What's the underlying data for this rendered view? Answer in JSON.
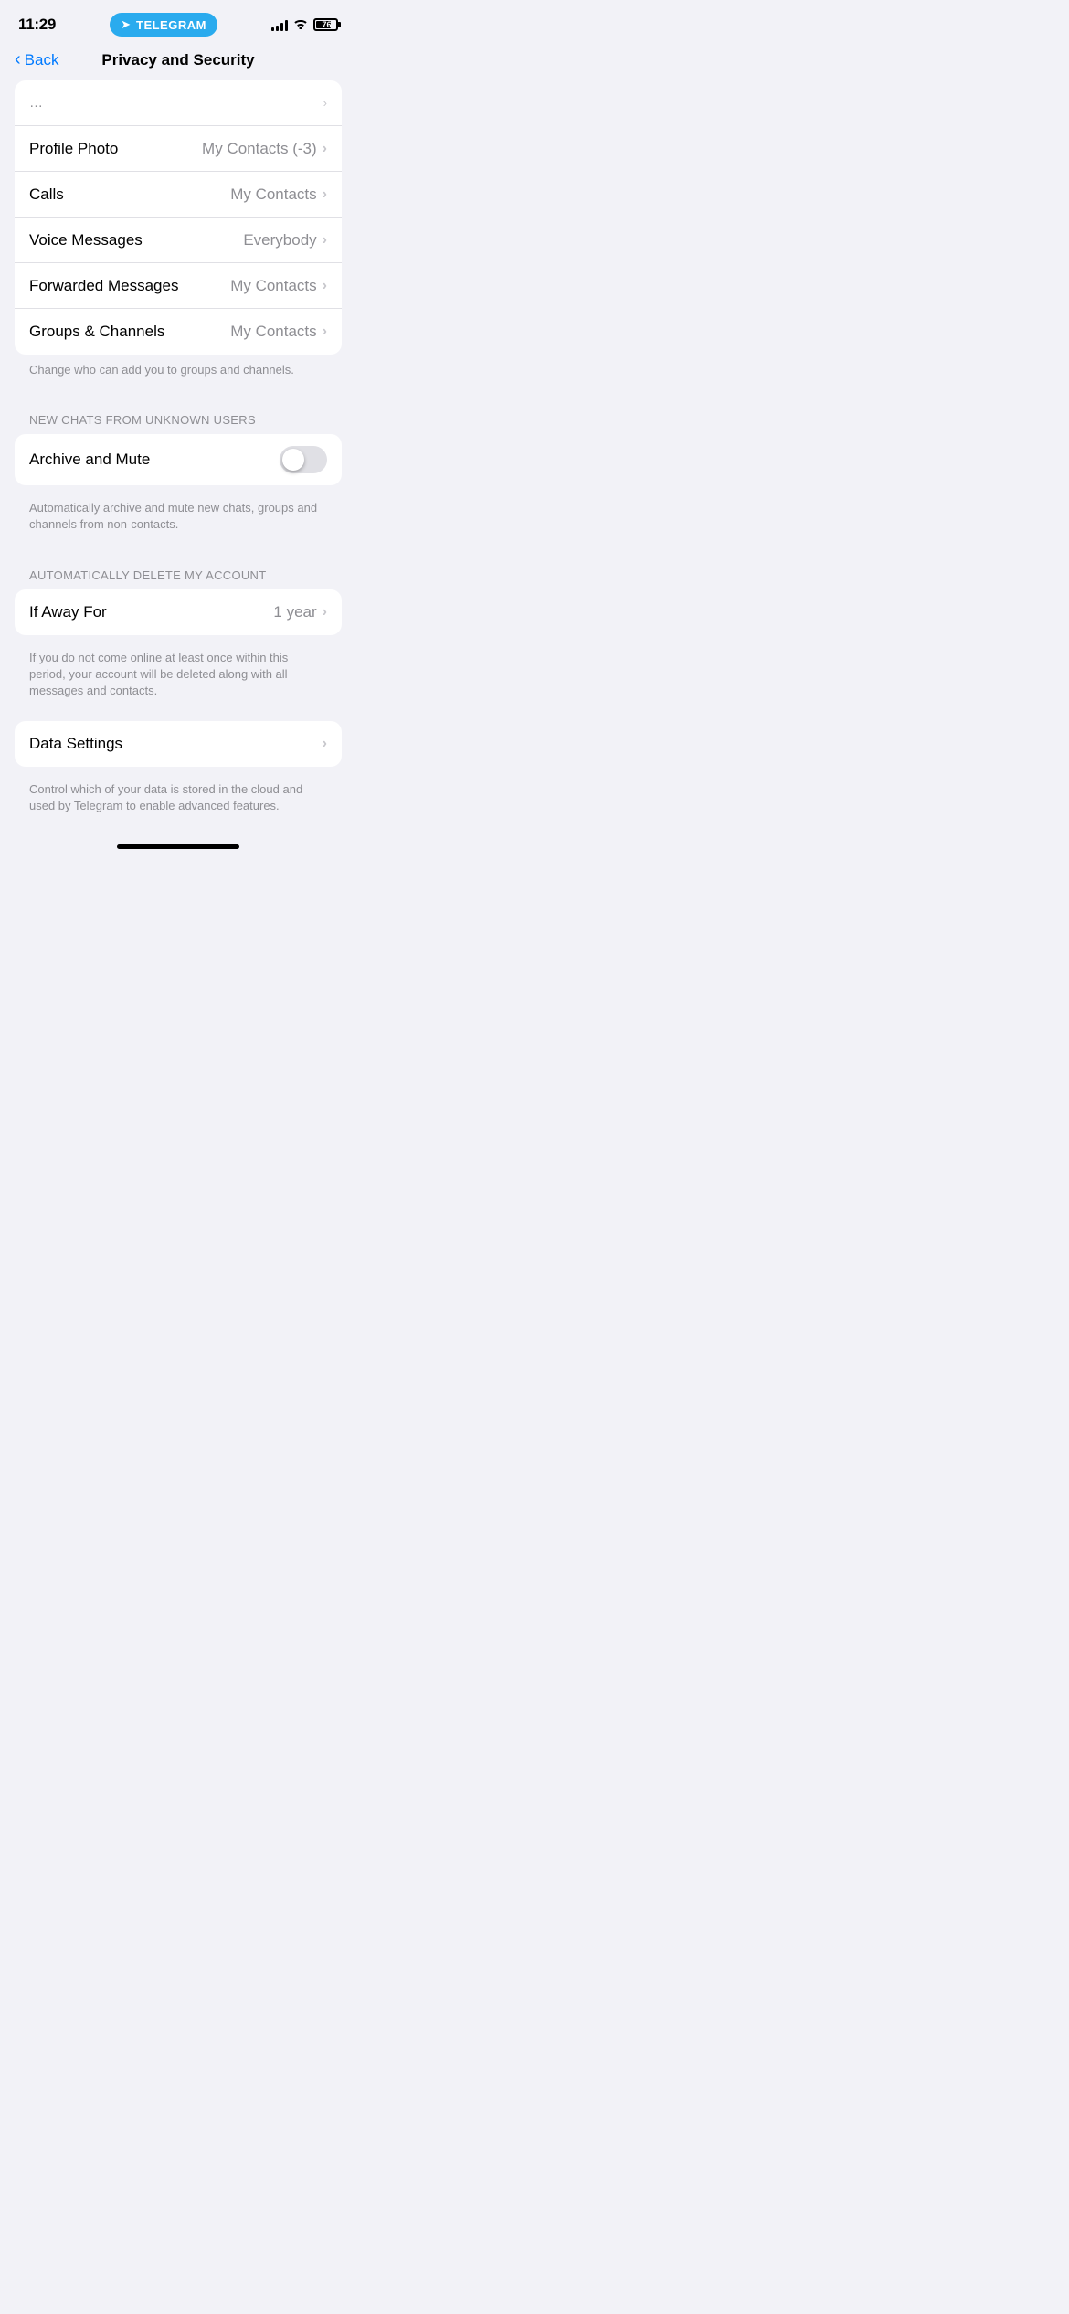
{
  "statusBar": {
    "time": "11:29",
    "telegram": {
      "label": "TELEGRAM"
    },
    "battery": "76"
  },
  "navBar": {
    "backLabel": "Back",
    "title": "Privacy and Security"
  },
  "privacySection": {
    "rows": [
      {
        "label": "Profile Photo",
        "value": "My Contacts (-3)"
      },
      {
        "label": "Calls",
        "value": "My Contacts"
      },
      {
        "label": "Voice Messages",
        "value": "Everybody"
      },
      {
        "label": "Forwarded Messages",
        "value": "My Contacts"
      },
      {
        "label": "Groups & Channels",
        "value": "My Contacts"
      }
    ],
    "footer": "Change who can add you to groups and channels."
  },
  "newChatsSection": {
    "header": "NEW CHATS FROM UNKNOWN USERS",
    "rows": [
      {
        "label": "Archive and Mute",
        "toggle": true,
        "toggleState": false
      }
    ],
    "footer": "Automatically archive and mute new chats, groups and channels from non-contacts."
  },
  "autoDeleteSection": {
    "header": "AUTOMATICALLY DELETE MY ACCOUNT",
    "rows": [
      {
        "label": "If Away For",
        "value": "1 year"
      }
    ],
    "footer": "If you do not come online at least once within this period, your account will be deleted along with all messages and contacts."
  },
  "dataSection": {
    "rows": [
      {
        "label": "Data Settings"
      }
    ],
    "footer": "Control which of your data is stored in the cloud and used by Telegram to enable advanced features."
  }
}
